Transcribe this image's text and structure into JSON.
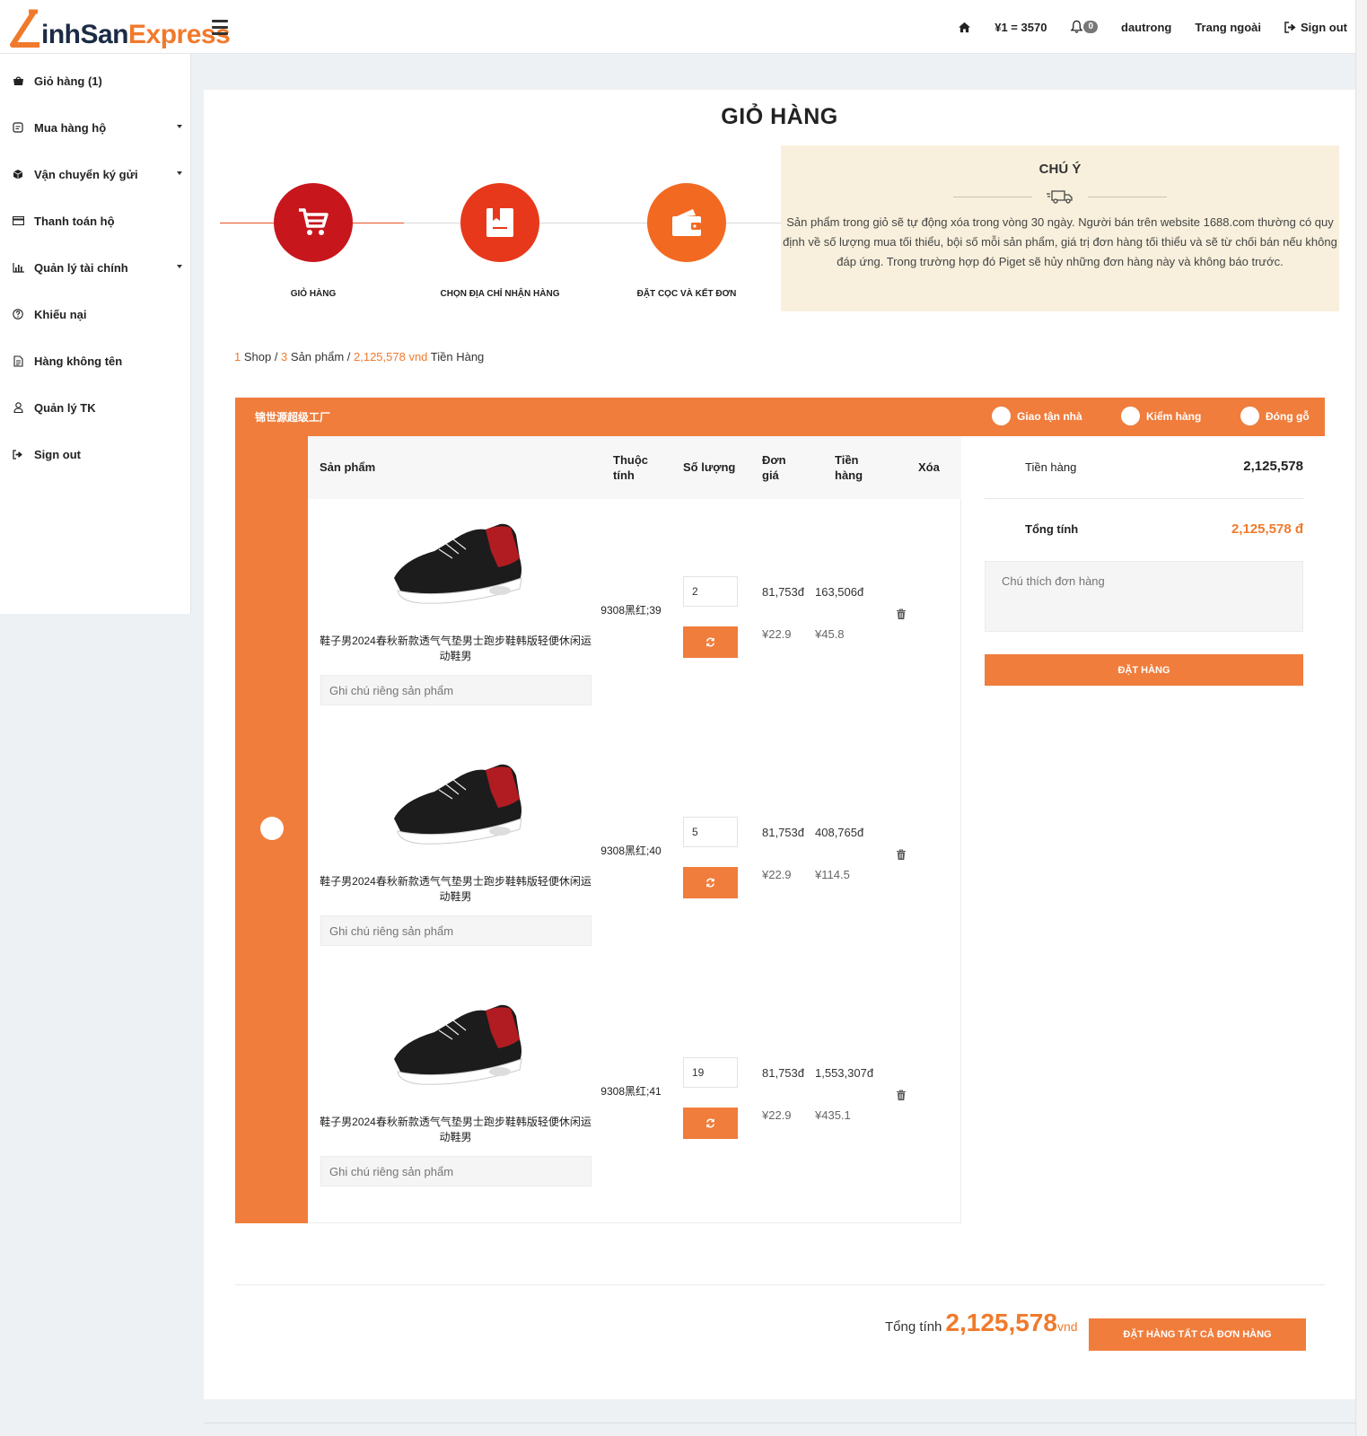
{
  "brand": {
    "part1": "inhSan",
    "part2": "Express",
    "accent": "#f07a2c"
  },
  "topnav": {
    "home_icon": "home-icon",
    "rate": "¥1 = 3570",
    "notif_count": "0",
    "username": "dautrong",
    "outside_link": "Trang ngoài",
    "signout": "Sign out"
  },
  "sidebar": {
    "items": [
      {
        "label": "Giỏ hàng (1)",
        "icon": "shopping-bag-icon"
      },
      {
        "label": "Mua hàng hộ",
        "icon": "order-icon"
      },
      {
        "label": "Vận chuyển ký gửi",
        "icon": "box-icon"
      },
      {
        "label": "Thanh toán hộ",
        "icon": "credit-card-icon"
      },
      {
        "label": "Quản lý tài chính",
        "icon": "bar-chart-icon"
      },
      {
        "label": "Khiếu nại",
        "icon": "question-icon"
      },
      {
        "label": "Hàng không tên",
        "icon": "document-icon"
      },
      {
        "label": "Quản lý TK",
        "icon": "user-icon"
      },
      {
        "label": "Sign out",
        "icon": "sign-out-icon"
      }
    ]
  },
  "page": {
    "title": "GIỎ HÀNG"
  },
  "steps": [
    {
      "label": "GIỎ HÀNG",
      "color": "#c8161d",
      "icon": "cart-icon"
    },
    {
      "label": "CHỌN ĐỊA CHỈ NHẬN HÀNG",
      "color": "#e8381b",
      "icon": "address-book-icon"
    },
    {
      "label": "ĐẶT CỌC VÀ KẾT ĐƠN",
      "color": "#f26a21",
      "icon": "wallet-icon"
    }
  ],
  "notice": {
    "title": "CHÚ Ý",
    "icon": "truck-icon",
    "text": "Sản phẩm trong giỏ sẽ tự động xóa trong vòng 30 ngày. Người bán trên website 1688.com thường có quy định về số lượng mua tối thiểu, bội số mỗi sản phẩm, giá trị đơn hàng tối thiểu và sẽ từ chối bán nếu không đáp ứng. Trong trường hợp đó Piget sẽ hủy những đơn hàng này và không báo trước."
  },
  "breadcrumb": {
    "shop_count": "1",
    "shop_label": " Shop / ",
    "product_count": "3",
    "product_label": " Sản phẩm / ",
    "amount": "2,125,578 vnd",
    "amount_label": " Tiền Hàng"
  },
  "shop": {
    "name": "锦世源超级工厂",
    "options": [
      "Giao tận nhà",
      "Kiểm hàng",
      "Đóng gỗ"
    ],
    "headers": {
      "product": "Sản phẩm",
      "attr": "Thuộc tính",
      "qty": "Số lượng",
      "price": "Đơn giá",
      "total": "Tiền hàng",
      "delete": "Xóa"
    },
    "items": [
      {
        "name": "鞋子男2024春秋新款透气气垫男士跑步鞋韩版轻便休闲运动鞋男",
        "attr": "9308黑红;39",
        "qty": "2",
        "price_vnd": "81,753đ",
        "total_vnd": "163,506đ",
        "price_cny": "¥22.9",
        "total_cny": "¥45.8",
        "note_placeholder": "Ghi chú riêng sản phẩm"
      },
      {
        "name": "鞋子男2024春秋新款透气气垫男士跑步鞋韩版轻便休闲运动鞋男",
        "attr": "9308黑红;40",
        "qty": "5",
        "price_vnd": "81,753đ",
        "total_vnd": "408,765đ",
        "price_cny": "¥22.9",
        "total_cny": "¥114.5",
        "note_placeholder": "Ghi chú riêng sản phẩm"
      },
      {
        "name": "鞋子男2024春秋新款透气气垫男士跑步鞋韩版轻便休闲运动鞋男",
        "attr": "9308黑红;41",
        "qty": "19",
        "price_vnd": "81,753đ",
        "total_vnd": "1,553,307đ",
        "price_cny": "¥22.9",
        "total_cny": "¥435.1",
        "note_placeholder": "Ghi chú riêng sản phẩm"
      }
    ],
    "summary": {
      "subtotal_label": "Tiền hàng",
      "subtotal": "2,125,578",
      "total_label": "Tổng tính",
      "total": "2,125,578 đ",
      "note_placeholder": "Chú thích đơn hàng",
      "order_button": "ĐẶT HÀNG"
    }
  },
  "footer": {
    "total_label": "Tổng tính",
    "total": "2,125,578",
    "unit": "vnd",
    "order_all_button": "ĐẶT HÀNG TẤT CẢ ĐƠN HÀNG"
  }
}
